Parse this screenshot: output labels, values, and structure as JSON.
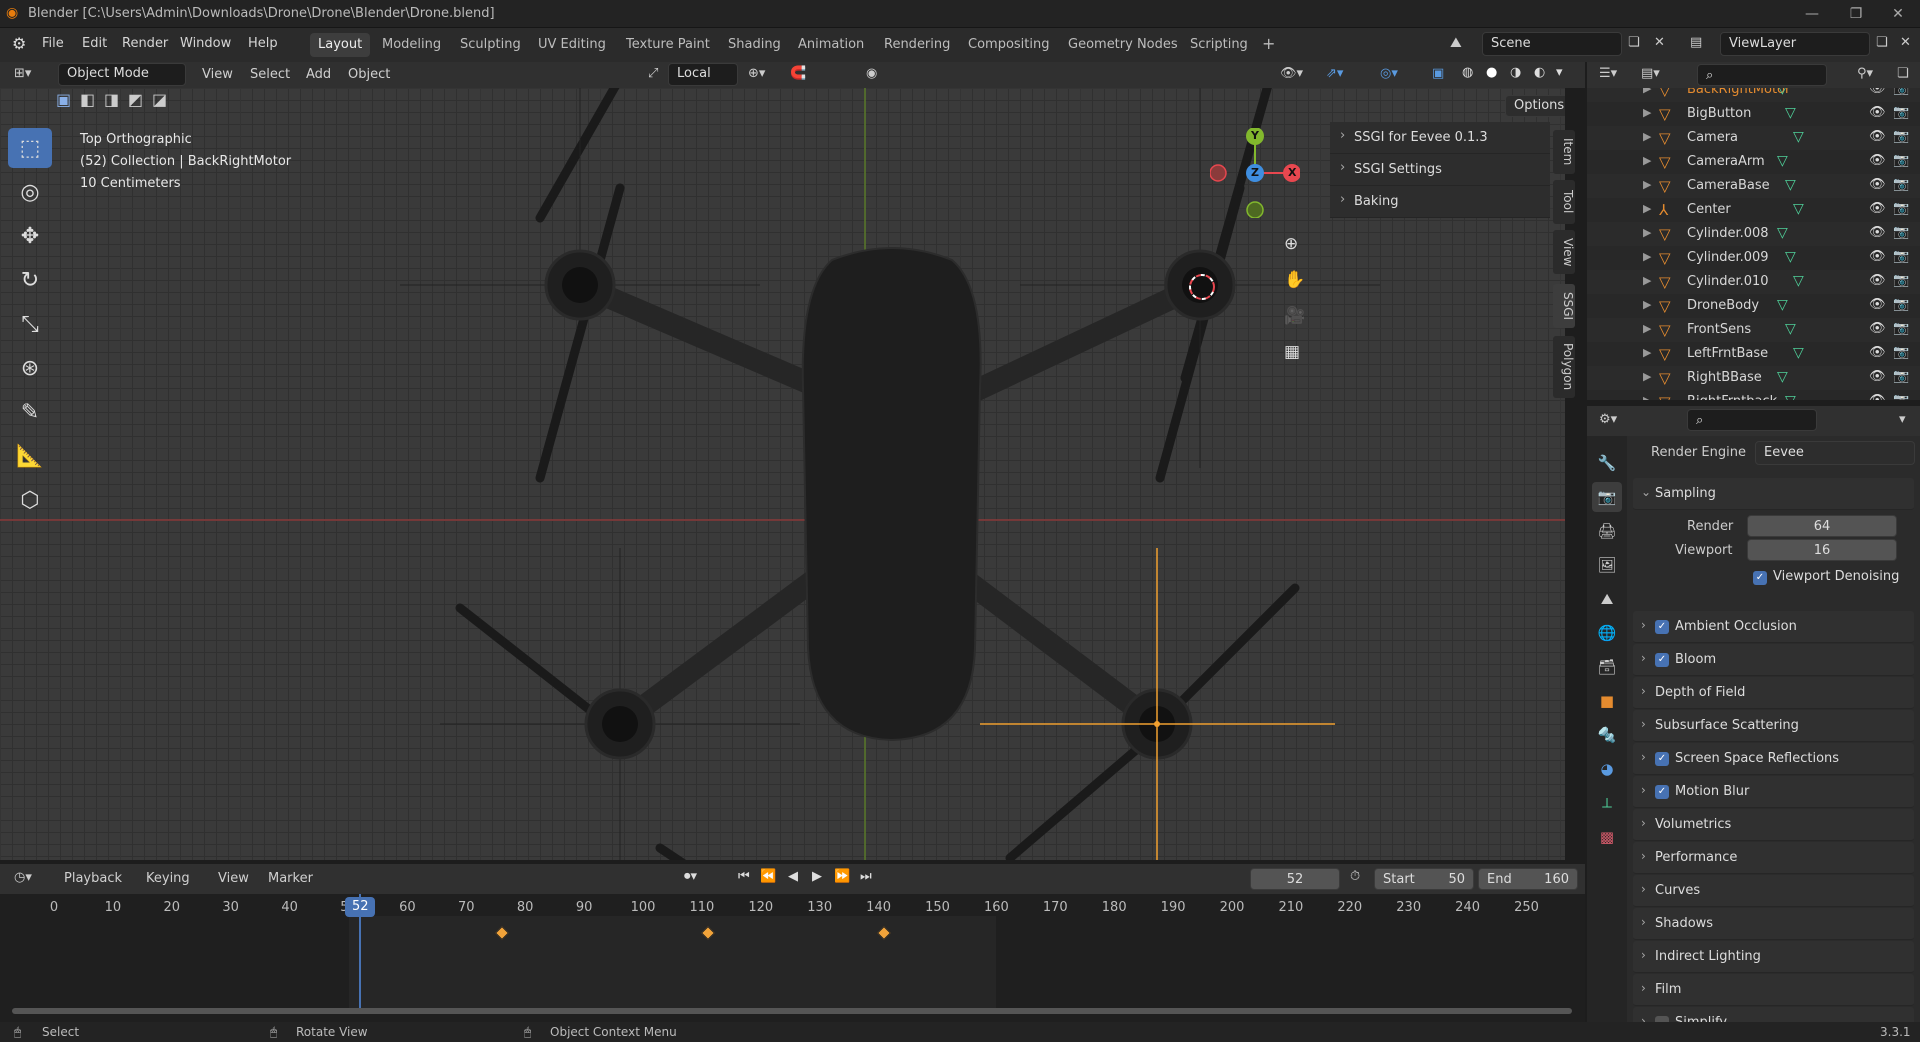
{
  "titlebar": {
    "title": "Blender [C:\\Users\\Admin\\Downloads\\Drone\\Drone\\Blender\\Drone.blend]"
  },
  "menus": [
    "File",
    "Edit",
    "Render",
    "Window",
    "Help"
  ],
  "workspaces": [
    "Layout",
    "Modeling",
    "Sculpting",
    "UV Editing",
    "Texture Paint",
    "Shading",
    "Animation",
    "Rendering",
    "Compositing",
    "Geometry Nodes",
    "Scripting"
  ],
  "active_workspace": "Layout",
  "scene": {
    "label": "Scene",
    "viewlayer": "ViewLayer"
  },
  "viewport_header": {
    "mode": "Object Mode",
    "menus": [
      "View",
      "Select",
      "Add",
      "Object"
    ],
    "transform_orientation": "Local",
    "options_label": "Options"
  },
  "viewport_overlay": {
    "view_name": "Top Orthographic",
    "collection": "(52) Collection | BackRightMotor",
    "scale": "10 Centimeters"
  },
  "gizmo": {
    "x": "X",
    "y": "Y",
    "z": "Z"
  },
  "n_panel": {
    "items": [
      "SSGI for Eevee 0.1.3",
      "SSGI Settings",
      "Baking"
    ],
    "tabs": [
      "Item",
      "Tool",
      "View",
      "SSGI",
      "Polygon"
    ]
  },
  "outliner": {
    "items": [
      {
        "name": "BackRightMotor"
      },
      {
        "name": "BigButton"
      },
      {
        "name": "Camera"
      },
      {
        "name": "CameraArm"
      },
      {
        "name": "CameraBase"
      },
      {
        "name": "Center"
      },
      {
        "name": "Cylinder.008"
      },
      {
        "name": "Cylinder.009"
      },
      {
        "name": "Cylinder.010"
      },
      {
        "name": "DroneBody"
      },
      {
        "name": "FrontSens"
      },
      {
        "name": "LeftFrntBase"
      },
      {
        "name": "RightBBase"
      },
      {
        "name": "RightFrntback"
      }
    ]
  },
  "properties": {
    "render_engine_label": "Render Engine",
    "render_engine": "Eevee",
    "sampling": {
      "label": "Sampling",
      "render_label": "Render",
      "render_value": "64",
      "viewport_label": "Viewport",
      "viewport_value": "16",
      "denoise_label": "Viewport Denoising"
    },
    "sections": [
      {
        "label": "Ambient Occlusion",
        "checked": true
      },
      {
        "label": "Bloom",
        "checked": true
      },
      {
        "label": "Depth of Field",
        "checked": null
      },
      {
        "label": "Subsurface Scattering",
        "checked": null
      },
      {
        "label": "Screen Space Reflections",
        "checked": true
      },
      {
        "label": "Motion Blur",
        "checked": true
      },
      {
        "label": "Volumetrics",
        "checked": null
      },
      {
        "label": "Performance",
        "checked": null
      },
      {
        "label": "Curves",
        "checked": null
      },
      {
        "label": "Shadows",
        "checked": null
      },
      {
        "label": "Indirect Lighting",
        "checked": null
      },
      {
        "label": "Film",
        "checked": null
      },
      {
        "label": "Simplify",
        "checked": false
      }
    ]
  },
  "timeline": {
    "menus": [
      "Playback",
      "Keying",
      "View",
      "Marker"
    ],
    "current_frame": "52",
    "start_label": "Start",
    "start": "50",
    "end_label": "End",
    "end": "160",
    "ticks": [
      "0",
      "10",
      "20",
      "30",
      "40",
      "50",
      "60",
      "70",
      "80",
      "90",
      "100",
      "110",
      "120",
      "130",
      "140",
      "150",
      "160",
      "170",
      "180",
      "190",
      "200",
      "210",
      "220",
      "230",
      "240",
      "250"
    ],
    "keyframes": [
      76,
      111,
      141
    ]
  },
  "status": {
    "select": "Select",
    "rotate": "Rotate View",
    "context": "Object Context Menu",
    "version": "3.3.1"
  },
  "colors": {
    "accent": "#4772b3",
    "object": "#e48b2f",
    "x_axis": "#e8474f",
    "y_axis": "#82b82d",
    "z_axis": "#3f8ee0"
  }
}
